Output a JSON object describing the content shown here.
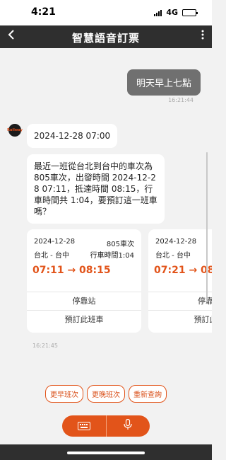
{
  "status_bar": {
    "time": "4:21",
    "network": "4G"
  },
  "nav": {
    "back_icon": "chevron-left-icon",
    "title": "智慧語音訂票",
    "more_icon": "more-vert-icon"
  },
  "messages": {
    "user": {
      "text": "明天早上七點",
      "time": "16:21:44"
    },
    "bot_date": "2024-12-28 07:00",
    "bot_reply": "最近一班從台北到台中的車次為805車次，出發時間 2024-12-28 07:11，抵達時間 08:15，行車時間共 1:04，要預訂這一班車嗎？",
    "bot_time": "16:21:45"
  },
  "train_cards": [
    {
      "date": "2024-12-28",
      "train_no": "805車次",
      "route": "台北 - 台中",
      "duration": "行車時間1:04",
      "times": "07:11 → 08:15",
      "stops_label": "停靠站",
      "book_label": "預訂此班車"
    },
    {
      "date": "2024-12-28",
      "train_no": "",
      "route": "台北 - 台中",
      "duration": "",
      "times": "07:21 → 08:",
      "stops_label": "停靠",
      "book_label": "預訂此"
    }
  ],
  "quick_actions": [
    "更早班次",
    "更晚班次",
    "重新查詢"
  ],
  "input_bar": {
    "keyboard_icon": "keyboard-icon",
    "mic_icon": "microphone-icon"
  },
  "colors": {
    "accent": "#e2541a",
    "header": "#2f2f2f",
    "background": "#f2f2f2",
    "user_bubble": "#707070"
  }
}
